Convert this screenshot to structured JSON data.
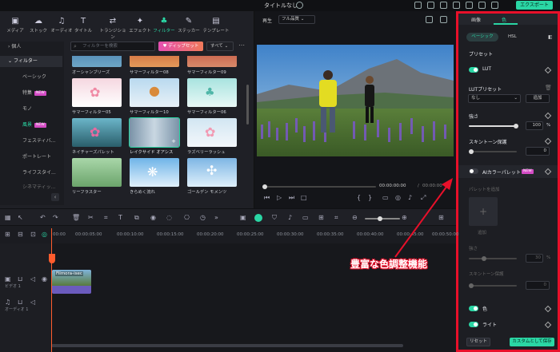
{
  "titlebar": {
    "title": "タイトルなし",
    "export": "エクスポート"
  },
  "library": {
    "tabs": [
      {
        "label": "メディア",
        "icon": "media-icon"
      },
      {
        "label": "ストック",
        "icon": "stock-icon"
      },
      {
        "label": "オーディオ",
        "icon": "audio-icon"
      },
      {
        "label": "タイトル",
        "icon": "title-icon"
      },
      {
        "label": "トランジション",
        "icon": "transition-icon"
      },
      {
        "label": "エフェクト",
        "icon": "effect-icon"
      },
      {
        "label": "フィルター",
        "icon": "filter-icon"
      },
      {
        "label": "ステッカー",
        "icon": "sticker-icon"
      },
      {
        "label": "テンプレート",
        "icon": "template-icon"
      }
    ],
    "sidebar": {
      "personal": "個人",
      "filters": "フィルター",
      "items": [
        "ベーシック",
        "特集",
        "モノ",
        "風景",
        "フェスティバ...",
        "ポートレート",
        "ライフスタイ...",
        "シネマティッ..."
      ]
    },
    "badge_new": "NEW",
    "search_placeholder": "フィルターを検索",
    "dip_button": "ディップセット",
    "all_select": "すべて",
    "thumbs": [
      {
        "caption": "オーシャンブリーズ"
      },
      {
        "caption": "サマーフィルター08"
      },
      {
        "caption": "サマーフィルター09"
      },
      {
        "caption": "サマーフィルター05"
      },
      {
        "caption": "サマーフィルター10"
      },
      {
        "caption": "サマーフィルター06"
      },
      {
        "caption": "ネイチャーズパレット"
      },
      {
        "caption": "レイクサイド オアシス"
      },
      {
        "caption": "ラズベリーラッシュ"
      },
      {
        "caption": "リーフラスター"
      },
      {
        "caption": "きらめく流れ"
      },
      {
        "caption": "ゴールデン モメンツ"
      }
    ]
  },
  "preview": {
    "play_label": "再生",
    "quality": "フル品質",
    "timecode_current": "00:00:00:00",
    "timecode_total": "00:00:00"
  },
  "inspector": {
    "tabs": [
      "画像",
      "色"
    ],
    "subtabs": [
      "ベーシック",
      "HSL"
    ],
    "preset_label": "プリセット",
    "lut_label": "LUT",
    "lut_preset_label": "LUTプリセット",
    "lut_value": "なし",
    "add_label": "追加",
    "strength_label": "強さ",
    "strength_value": "100",
    "strength_unit": "%",
    "skin_label": "スキントーン保護",
    "skin_value": "0",
    "ai_palette_label": "AIカラーパレット",
    "palette_add_label": "パレットを追加",
    "add_small": "追加",
    "strength2_label": "強さ",
    "strength2_value": "30",
    "strength2_unit": "%",
    "skin2_label": "スキントーン保護",
    "skin2_value": "0",
    "color_label": "色",
    "light_label": "ライト",
    "reset_label": "リセット",
    "save_custom_label": "カスタムとして保存"
  },
  "timeline": {
    "ruler": [
      "00:00",
      "00:00:05:00",
      "00:00:10:00",
      "00:00:15:00",
      "00:00:20:00",
      "00:00:25:00",
      "00:00:30:00",
      "00:00:35:00",
      "00:00:40:00",
      "00:00:45:00",
      "00:00:50:00"
    ],
    "video_track_label": "ビデオ 1",
    "audio_track_label": "オーディオ 1",
    "clip_label": "Filmora-isec"
  },
  "annotation": {
    "callout": "豊富な色調整機能"
  }
}
